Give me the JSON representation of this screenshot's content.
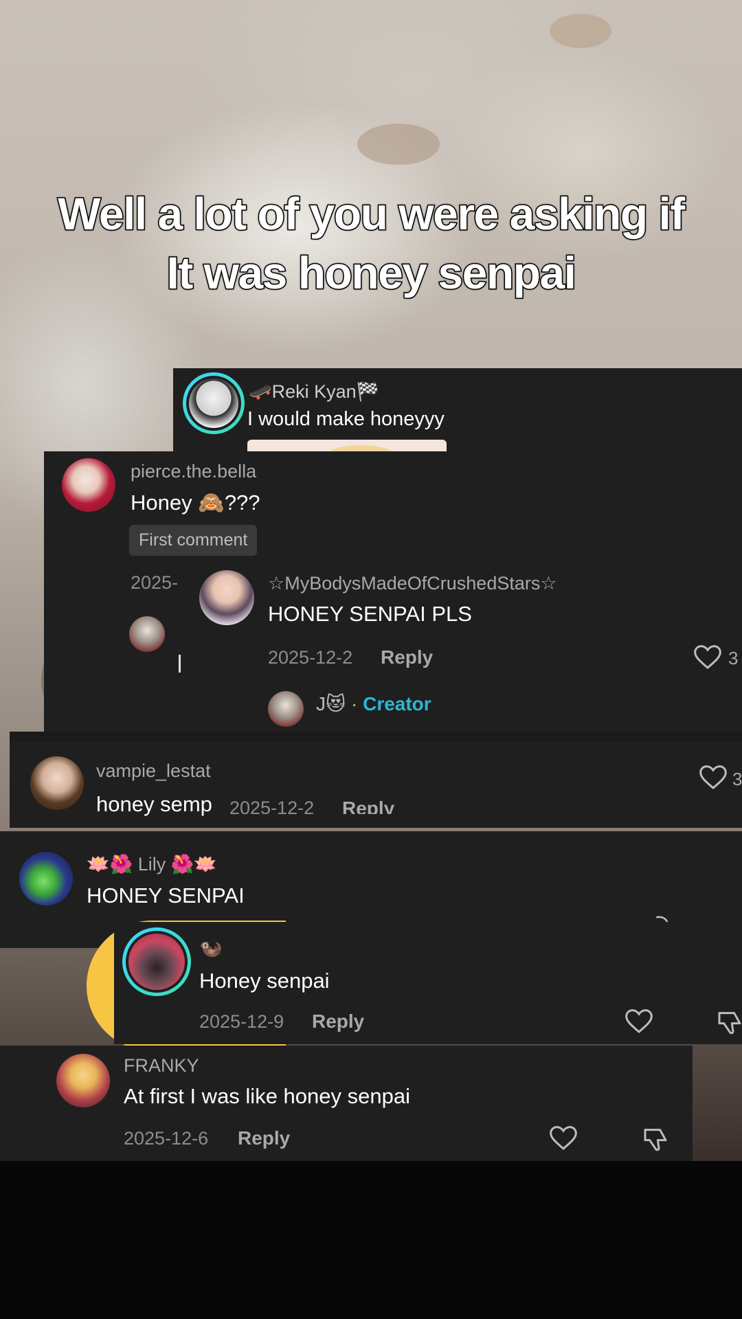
{
  "caption": {
    "line1": "Well a lot of you were asking if",
    "line2": "It was honey senpai"
  },
  "comments": {
    "reki": {
      "username": "🛹Reki Kyan🏁",
      "text": "I would make honeyyy"
    },
    "pierce": {
      "username": "pierce.the.bella",
      "text": "Honey 🙈???",
      "badge": "First comment",
      "date": "2025-"
    },
    "stars": {
      "username": "☆MyBodysMadeOfCrushedStars☆",
      "text": "HONEY SENPAI PLS",
      "date": "2025-12-2",
      "reply": "Reply",
      "likes": "3",
      "creator_name": "J😻",
      "creator_sep": "·",
      "creator_label": "Creator"
    },
    "vampie": {
      "username": "vampie_lestat",
      "text": "honey sempi",
      "likes": "3",
      "overlap_date": "2025-12-2",
      "overlap_reply": "Reply"
    },
    "lily": {
      "username": "🪷🌺 Lily 🌺🪷",
      "text": "HONEY SENPAI"
    },
    "otter": {
      "username": "🦦",
      "text": "Honey senpai",
      "date": "2025-12-9",
      "reply": "Reply"
    },
    "franky": {
      "username": "FRANKY",
      "text": "At first I was like honey senpai",
      "date": "2025-12-6",
      "reply": "Reply"
    }
  },
  "icons": [
    "heart-icon",
    "dislike-icon",
    "avatar"
  ]
}
